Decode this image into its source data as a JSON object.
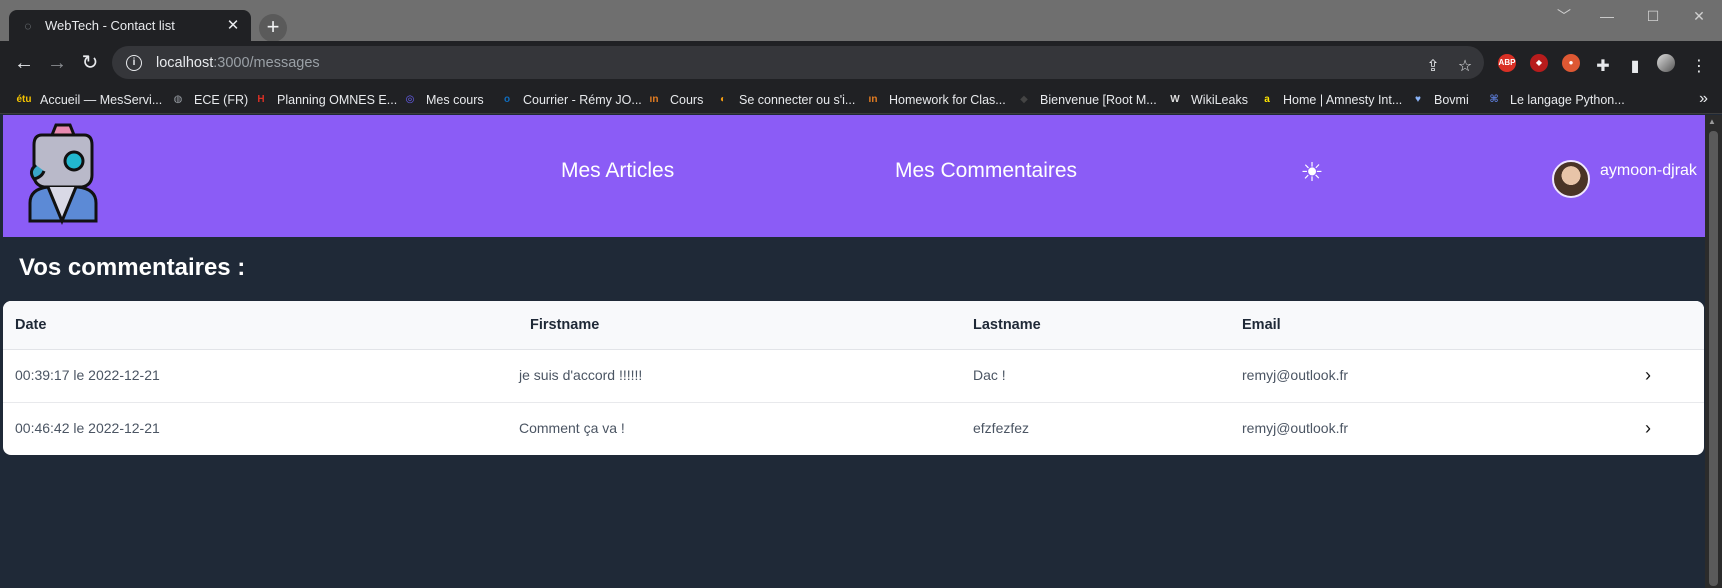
{
  "browser": {
    "tab_title": "WebTech - Contact list",
    "tab_close": "✕",
    "new_tab": "+",
    "url_host": "localhost",
    "url_path": ":3000/messages",
    "window_controls": [
      "﹀",
      "—",
      "☐",
      "✕"
    ],
    "bookmarks": [
      {
        "label": "Accueil — MesServi...",
        "icon": "étu",
        "color": "#f5c400"
      },
      {
        "label": "ECE (FR)",
        "icon": "◍",
        "color": "#9aa0a6"
      },
      {
        "label": "Planning OMNES E...",
        "icon": "H",
        "color": "#d93025"
      },
      {
        "label": "Mes cours",
        "icon": "◎",
        "color": "#6c63ff"
      },
      {
        "label": "Courrier - Rémy JO...",
        "icon": "o",
        "color": "#0f6cbd"
      },
      {
        "label": "Cours",
        "icon": "ın",
        "color": "#e67e22"
      },
      {
        "label": "Se connecter ou s'i...",
        "icon": "◐",
        "color": "#f39c12"
      },
      {
        "label": "Homework for Clas...",
        "icon": "ın",
        "color": "#e67e22"
      },
      {
        "label": "Bienvenue [Root M...",
        "icon": "◆",
        "color": "#444"
      },
      {
        "label": "WikiLeaks",
        "icon": "W",
        "color": "#dddddd"
      },
      {
        "label": "Home | Amnesty Int...",
        "icon": "a",
        "color": "#ffe600"
      },
      {
        "label": "Bovmi",
        "icon": "♥",
        "color": "#8ab4f8"
      },
      {
        "label": "Le langage Python...",
        "icon": "⌘",
        "color": "#5b7bd5"
      }
    ],
    "bookmarks_more": "»",
    "extensions": [
      {
        "name": "adblock-plus-icon",
        "text": "ABP",
        "color": "#d93025"
      },
      {
        "name": "ublock-icon",
        "text": "◆",
        "color": "#b71c1c"
      },
      {
        "name": "duckduckgo-icon",
        "text": "●",
        "color": "#de5833"
      }
    ]
  },
  "header": {
    "nav_articles": "Mes Articles",
    "nav_comments": "Mes Commentaires",
    "theme_icon": "☀",
    "username": "aymoon-djrak",
    "accent": "#8b5cf6"
  },
  "main": {
    "title": "Vos commentaires :",
    "columns": [
      "Date",
      "Firstname",
      "Lastname",
      "Email"
    ],
    "rows": [
      {
        "date": "00:39:17 le 2022-12-21",
        "firstname": "je suis d'accord !!!!!!",
        "lastname": "Dac !",
        "email": "remyj@outlook.fr",
        "chevron": "›"
      },
      {
        "date": "00:46:42 le 2022-12-21",
        "firstname": "Comment ça va !",
        "lastname": "efzfezfez",
        "email": "remyj@outlook.fr",
        "chevron": "›"
      }
    ]
  }
}
